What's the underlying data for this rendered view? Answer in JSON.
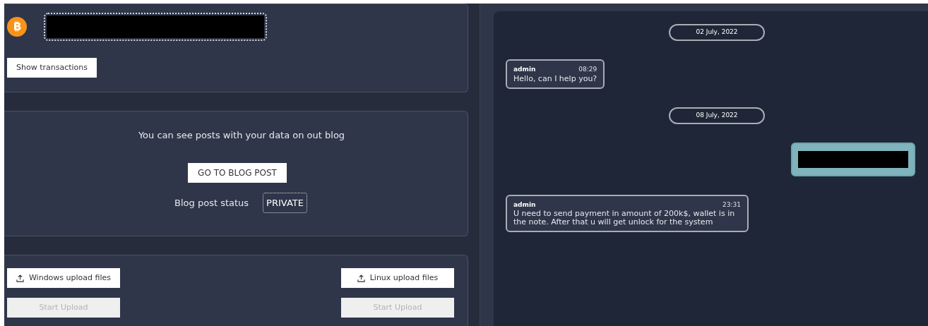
{
  "wallet": {
    "show_transactions_button": "Show transactions"
  },
  "blog": {
    "message": "You can see posts with your data on out blog",
    "button": "GO TO BLOG POST",
    "status_label": "Blog post status",
    "status": "PRIVATE"
  },
  "uploads": [
    {
      "button": "Windows upload files",
      "start": "Start Upload",
      "start_disabled": true
    },
    {
      "button": "Linux upload files",
      "start": "Start Upload",
      "start_disabled": true
    }
  ],
  "chat": [
    {
      "kind": "date",
      "text": "02 July, 2022"
    },
    {
      "kind": "incoming",
      "author": "admin",
      "time": "08:29",
      "text": "Hello, can I help you?"
    },
    {
      "kind": "date",
      "text": "08 July, 2022"
    },
    {
      "kind": "outgoing"
    },
    {
      "kind": "incoming",
      "author": "admin",
      "time": "23:31",
      "text": "U need to send payment in amount of 200k$, wallet is in the note. After that u will get unlock for the system"
    }
  ]
}
